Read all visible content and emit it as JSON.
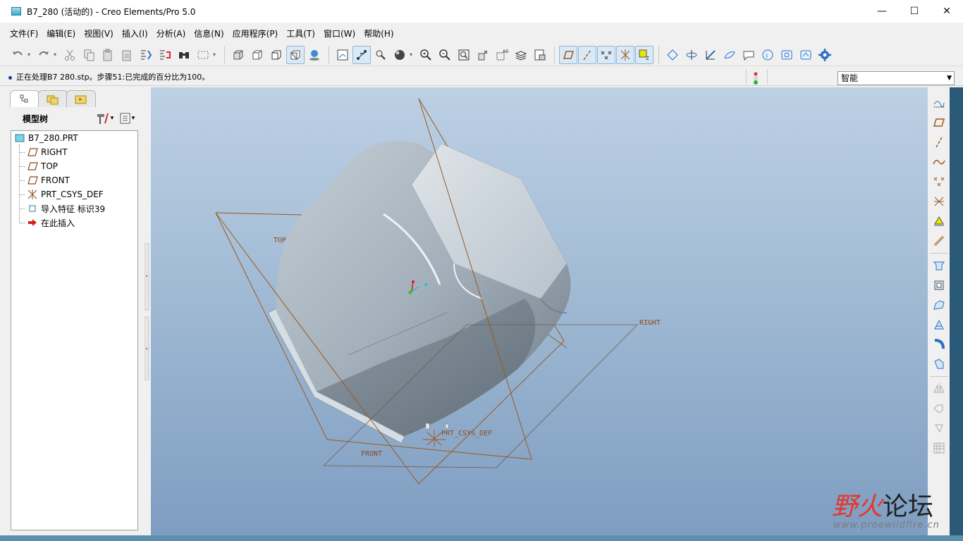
{
  "window": {
    "title": "B7_280 (活动的) - Creo Elements/Pro 5.0",
    "minimize": "—",
    "maximize": "☐",
    "close": "✕"
  },
  "menu": [
    "文件(F)",
    "编辑(E)",
    "视图(V)",
    "插入(I)",
    "分析(A)",
    "信息(N)",
    "应用程序(P)",
    "工具(T)",
    "窗口(W)",
    "帮助(H)"
  ],
  "status": {
    "message": "正在处理B7 280.stp。步骤51:已完成的百分比为100。",
    "filter_value": "智能"
  },
  "model_tree": {
    "title": "模型树",
    "items": [
      {
        "label": "B7_280.PRT",
        "icon": "part-icon"
      },
      {
        "label": "RIGHT",
        "icon": "datum-plane-icon"
      },
      {
        "label": "TOP",
        "icon": "datum-plane-icon"
      },
      {
        "label": "FRONT",
        "icon": "datum-plane-icon"
      },
      {
        "label": "PRT_CSYS_DEF",
        "icon": "csys-icon"
      },
      {
        "label": "导入特征 标识39",
        "icon": "import-feature-icon"
      },
      {
        "label": "在此插入",
        "icon": "insert-here-arrow-icon"
      }
    ]
  },
  "viewport": {
    "labels": {
      "top": "TOP",
      "right": "RIGHT",
      "front": "FRONT",
      "csys": "PRT_CSYS_DEF"
    },
    "colors": {
      "datum": "#9a5a22",
      "model_light": "#d6dde3",
      "model_dark": "#6e7b86"
    }
  },
  "watermark": {
    "chars_red": "野火",
    "chars_dark": "论坛",
    "url": "www.proewildfire.cn"
  }
}
